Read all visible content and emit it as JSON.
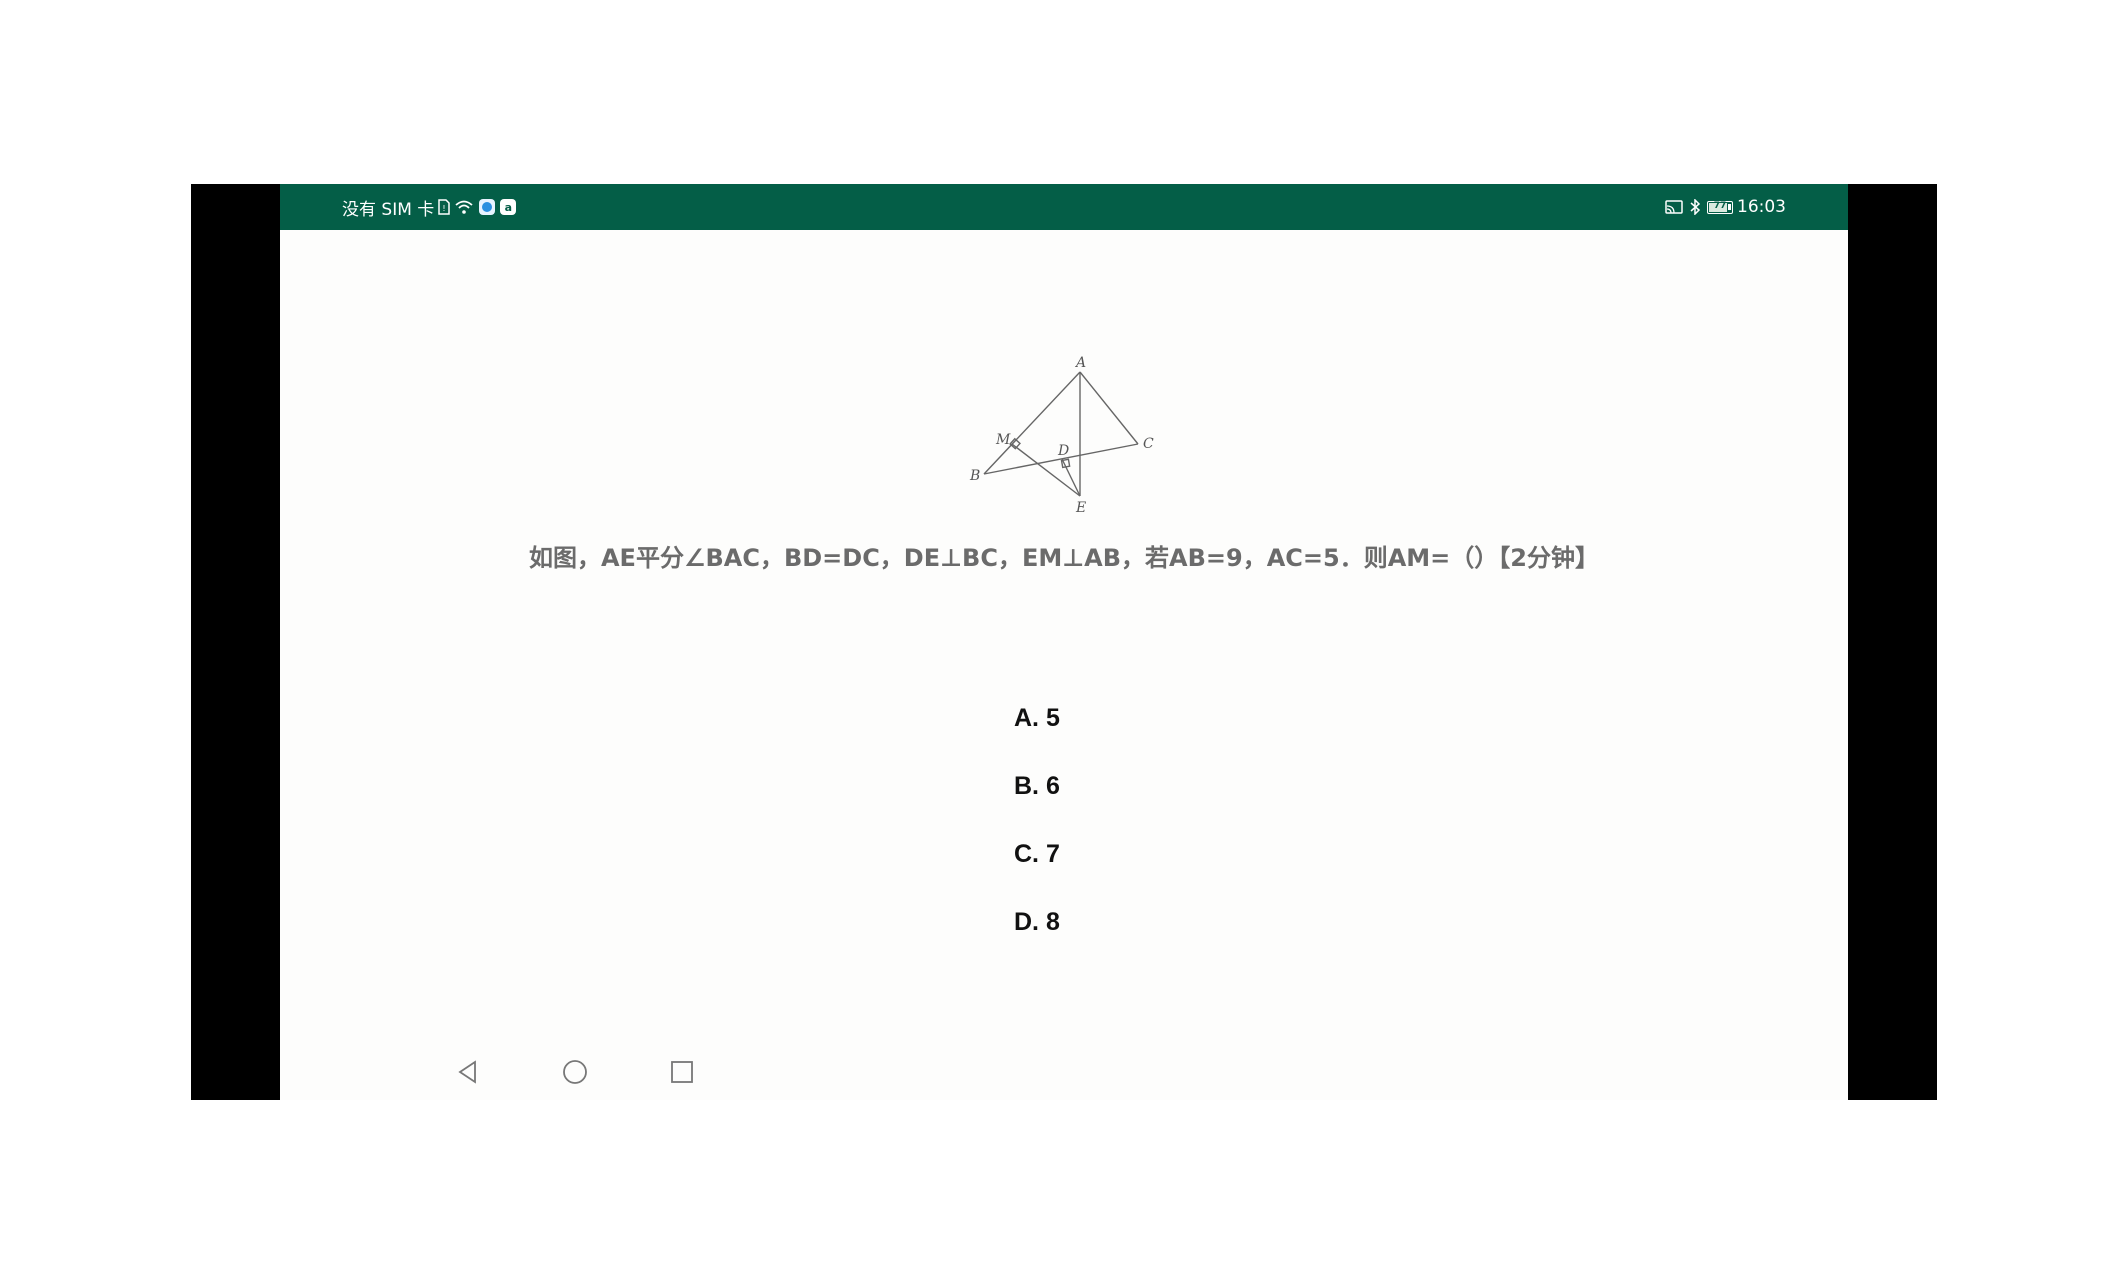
{
  "status_bar": {
    "carrier": "没有 SIM 卡",
    "app_badge": "a",
    "battery_level": "77",
    "battery_fraction": 0.77,
    "time": "16:03",
    "icons": [
      "sim-missing-icon",
      "wifi-icon",
      "app-icon",
      "cast-icon",
      "bluetooth-icon",
      "battery-icon"
    ]
  },
  "figure": {
    "labels": {
      "A": "A",
      "B": "B",
      "C": "C",
      "D": "D",
      "E": "E",
      "M": "M"
    }
  },
  "question": {
    "text": "如图，AE平分∠BAC，BD=DC，DE⊥BC，EM⊥AB，若AB=9，AC=5．则AM=（）【2分钟】"
  },
  "options": [
    {
      "label": "A. 5"
    },
    {
      "label": "B. 6"
    },
    {
      "label": "C. 7"
    },
    {
      "label": "D. 8"
    }
  ],
  "nav": {
    "icons": [
      "back-icon",
      "home-icon",
      "recents-icon"
    ]
  },
  "colors": {
    "status_bar_bg": "#045e47",
    "screen_bg": "#fdfdfc",
    "bezel": "#000000",
    "question_text": "#6b6b6b"
  }
}
